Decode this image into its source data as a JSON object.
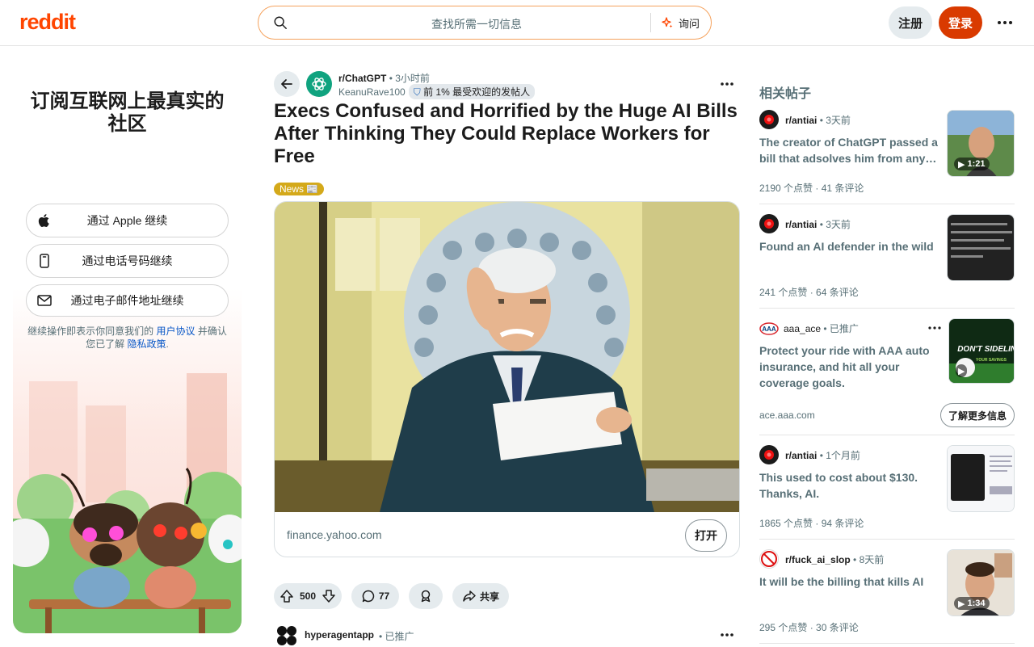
{
  "header": {
    "logo": "reddit",
    "search_placeholder": "查找所需一切信息",
    "ask_label": "询问",
    "signup_label": "注册",
    "login_label": "登录"
  },
  "promo": {
    "title": "订阅互联网上最真实的社区",
    "apple_label": "通过 Apple 继续",
    "phone_label": "通过电话号码继续",
    "email_label": "通过电子邮件地址继续",
    "terms_prefix": "继续操作即表示你同意我们的",
    "terms_link": "用户协议",
    "terms_mid": "并确认您已了解",
    "privacy_link": "隐私政策",
    "terms_suffix": "."
  },
  "post": {
    "subreddit": "r/ChatGPT",
    "time": "3小时前",
    "author": "KeanuRave100",
    "author_flair": "前 1% 最受欢迎的发帖人",
    "title": "Execs Confused and Horrified by the Huge AI Bills After Thinking They Could Replace Workers for Free",
    "flair": "News 📰",
    "link_domain": "finance.yahoo.com",
    "open_label": "打开",
    "score": "500",
    "comments": "77",
    "share_label": "共享"
  },
  "promoted_post": {
    "name": "hyperagentapp",
    "tag": "已推广"
  },
  "sidebar": {
    "title": "相关帖子",
    "items": [
      {
        "subreddit": "r/antiai",
        "time": "3天前",
        "title": "The creator of ChatGPT passed a bill that adsolves him from any…",
        "upvotes": "2190 个点赞",
        "comments": "41 条评论",
        "duration": "1:21"
      },
      {
        "subreddit": "r/antiai",
        "time": "3天前",
        "title": "Found an AI defender in the wild",
        "upvotes": "241 个点赞",
        "comments": "64 条评论"
      },
      {
        "subreddit": "aaa_ace",
        "time": "已推广",
        "title": "Protect your ride with AAA auto insurance, and hit all your coverage goals.",
        "domain": "ace.aaa.com",
        "cta": "了解更多信息",
        "thumb_text": "DON'T SIDELINE",
        "thumb_sub": "YOUR SAVINGS"
      },
      {
        "subreddit": "r/antiai",
        "time": "1个月前",
        "title": "This used to cost about $130. Thanks, AI.",
        "upvotes": "1865 个点赞",
        "comments": "94 条评论"
      },
      {
        "subreddit": "r/fuck_ai_slop",
        "time": "8天前",
        "title": "It will be the billing that kills AI",
        "upvotes": "295 个点赞",
        "comments": "30 条评论",
        "duration": "1:34"
      }
    ]
  }
}
